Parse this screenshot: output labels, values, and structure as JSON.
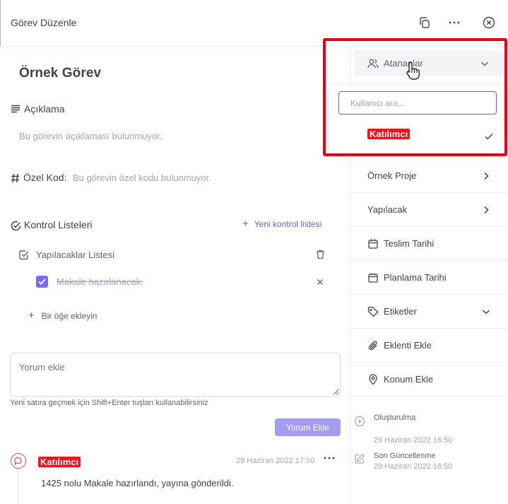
{
  "header": {
    "title": "Görev Düzenle",
    "icons": [
      "copy-icon",
      "more-icon",
      "close-icon"
    ]
  },
  "task": {
    "title": "Örnek Görev",
    "description_label": "Açıklama",
    "description_empty": "Bu görevin açıklaması bulunmuyor.",
    "custom_code_label": "Özel Kod:",
    "custom_code_empty": "Bu görevin özel kodu bulunmuyor."
  },
  "checklists": {
    "label": "Kontrol Listeleri",
    "new_label": "Yeni kontrol listesi",
    "list_name": "Yapılacaklar Listesi",
    "items": [
      {
        "text": "Makale hazırlanacak.",
        "checked": true
      }
    ],
    "add_item_label": "Bir öğe ekleyin"
  },
  "comment_form": {
    "placeholder": "Yorum ekle",
    "hint": "Yeni satıra geçmek için Shift+Enter tuşları kullanabilirsiniz",
    "submit_label": "Yorum Ekle"
  },
  "comment": {
    "author": "Katılımcı",
    "time": "29 Haziran 2022 17:50",
    "text": "1425 nolu Makale hazırlandı, yayına gönderildi."
  },
  "sidebar": {
    "assignees_label": "Atananlar",
    "search_placeholder": "Kullanıcı ara...",
    "dropdown_item": "Katılımcı",
    "project": "Örnek Proje",
    "status": "Yapılacak",
    "due_date": "Teslim Tarihi",
    "planned_date": "Planlama Tarihi",
    "tags": "Etiketler",
    "attachment": "Eklenti Ekle",
    "location": "Konum Ekle",
    "created_label": "Oluşturulma",
    "created_date": "29 Haziran 2022 16:50",
    "updated_label": "Son Güncellenme",
    "updated_date": "29 Haziran 2022 16:50"
  },
  "colors": {
    "accent": "#6e5bdf",
    "highlight": "#e3000f",
    "redaction": "#f1141c"
  }
}
